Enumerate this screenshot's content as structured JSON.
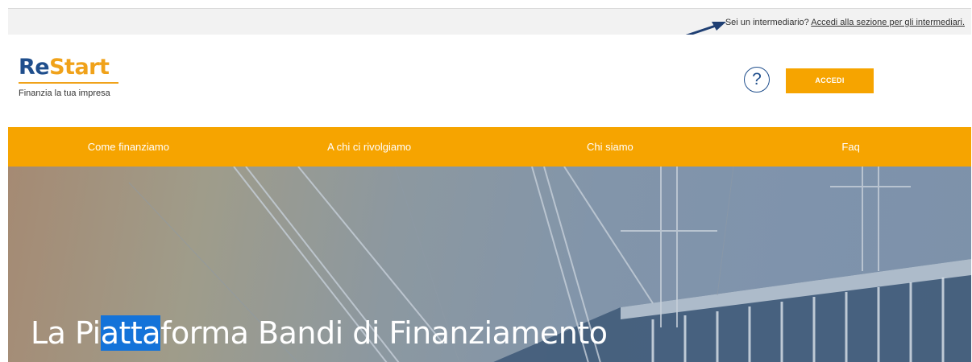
{
  "topbar": {
    "question": "Sei un intermediario?",
    "link": "Accedi alla sezione per gli intermediari."
  },
  "logo": {
    "part1": "Re",
    "part2": "Start",
    "tagline": "Finanzia la tua impresa"
  },
  "header": {
    "help_symbol": "?",
    "login_label": "ACCEDI"
  },
  "nav": [
    {
      "label": "Come finanziamo"
    },
    {
      "label": "A chi ci rivolgiamo"
    },
    {
      "label": "Chi siamo"
    },
    {
      "label": "Faq"
    }
  ],
  "hero": {
    "title_pre": "La Pi",
    "title_sel": "atta",
    "title_post": "forma Bandi di Finanziamento"
  },
  "colors": {
    "accent": "#f6a400",
    "brand_blue": "#1f4e8c",
    "selection": "#1473d9"
  },
  "icons": [
    "question-icon",
    "annotation-arrow-icon"
  ]
}
